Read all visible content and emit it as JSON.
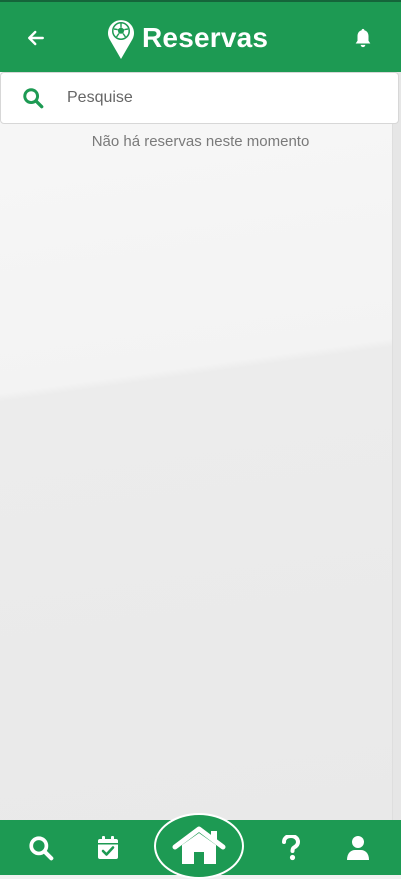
{
  "header": {
    "title": "Reservas",
    "back_icon": "arrow-left-icon",
    "logo_icon": "soccer-ball-pin-icon",
    "bell_icon": "bell-icon"
  },
  "search": {
    "placeholder": "Pesquise",
    "value": ""
  },
  "main": {
    "empty_message": "Não há reservas neste momento"
  },
  "bottom_nav": {
    "items": [
      {
        "id": "search",
        "icon": "search-icon"
      },
      {
        "id": "calendar",
        "icon": "calendar-check-icon"
      },
      {
        "id": "home",
        "icon": "home-icon"
      },
      {
        "id": "help",
        "icon": "question-icon"
      },
      {
        "id": "profile",
        "icon": "user-icon"
      }
    ]
  },
  "colors": {
    "brand_green": "#1d9a53",
    "text_muted": "#7a7a7a"
  }
}
